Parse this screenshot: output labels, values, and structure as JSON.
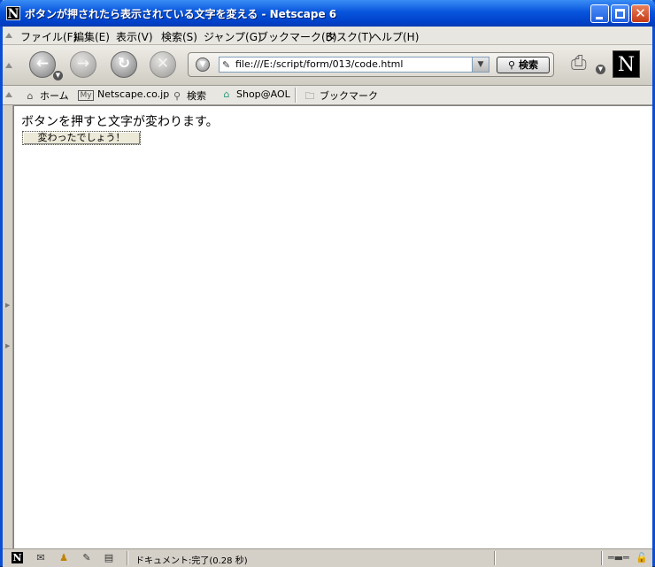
{
  "window": {
    "title": "ボタンが押されたら表示されている文字を変える - Netscape 6",
    "app_icon_letter": "N"
  },
  "menu": [
    "ファイル(F)",
    "編集(E)",
    "表示(V)",
    "検索(S)",
    "ジャンプ(G)",
    "ブックマーク(B)",
    "タスク(T)",
    "ヘルプ(H)"
  ],
  "navbar": {
    "url": "file:///E:/script/form/013/code.html",
    "search_label": "検索",
    "logo_letter": "N"
  },
  "personal_toolbar": {
    "items": [
      "ホーム",
      "Netscape.co.jp",
      "検索",
      "Shop@AOL",
      "ブックマーク"
    ],
    "my_badge": "My"
  },
  "page": {
    "text": "ボタンを押すと文字が変わります。",
    "button_label": "変わったでしょう！"
  },
  "status": {
    "text": "ドキュメント:完了(0.28 秒)"
  },
  "colors": {
    "titlebar": "#0855dd",
    "chrome": "#d4d0c8",
    "content_bg": "#ffffff"
  }
}
